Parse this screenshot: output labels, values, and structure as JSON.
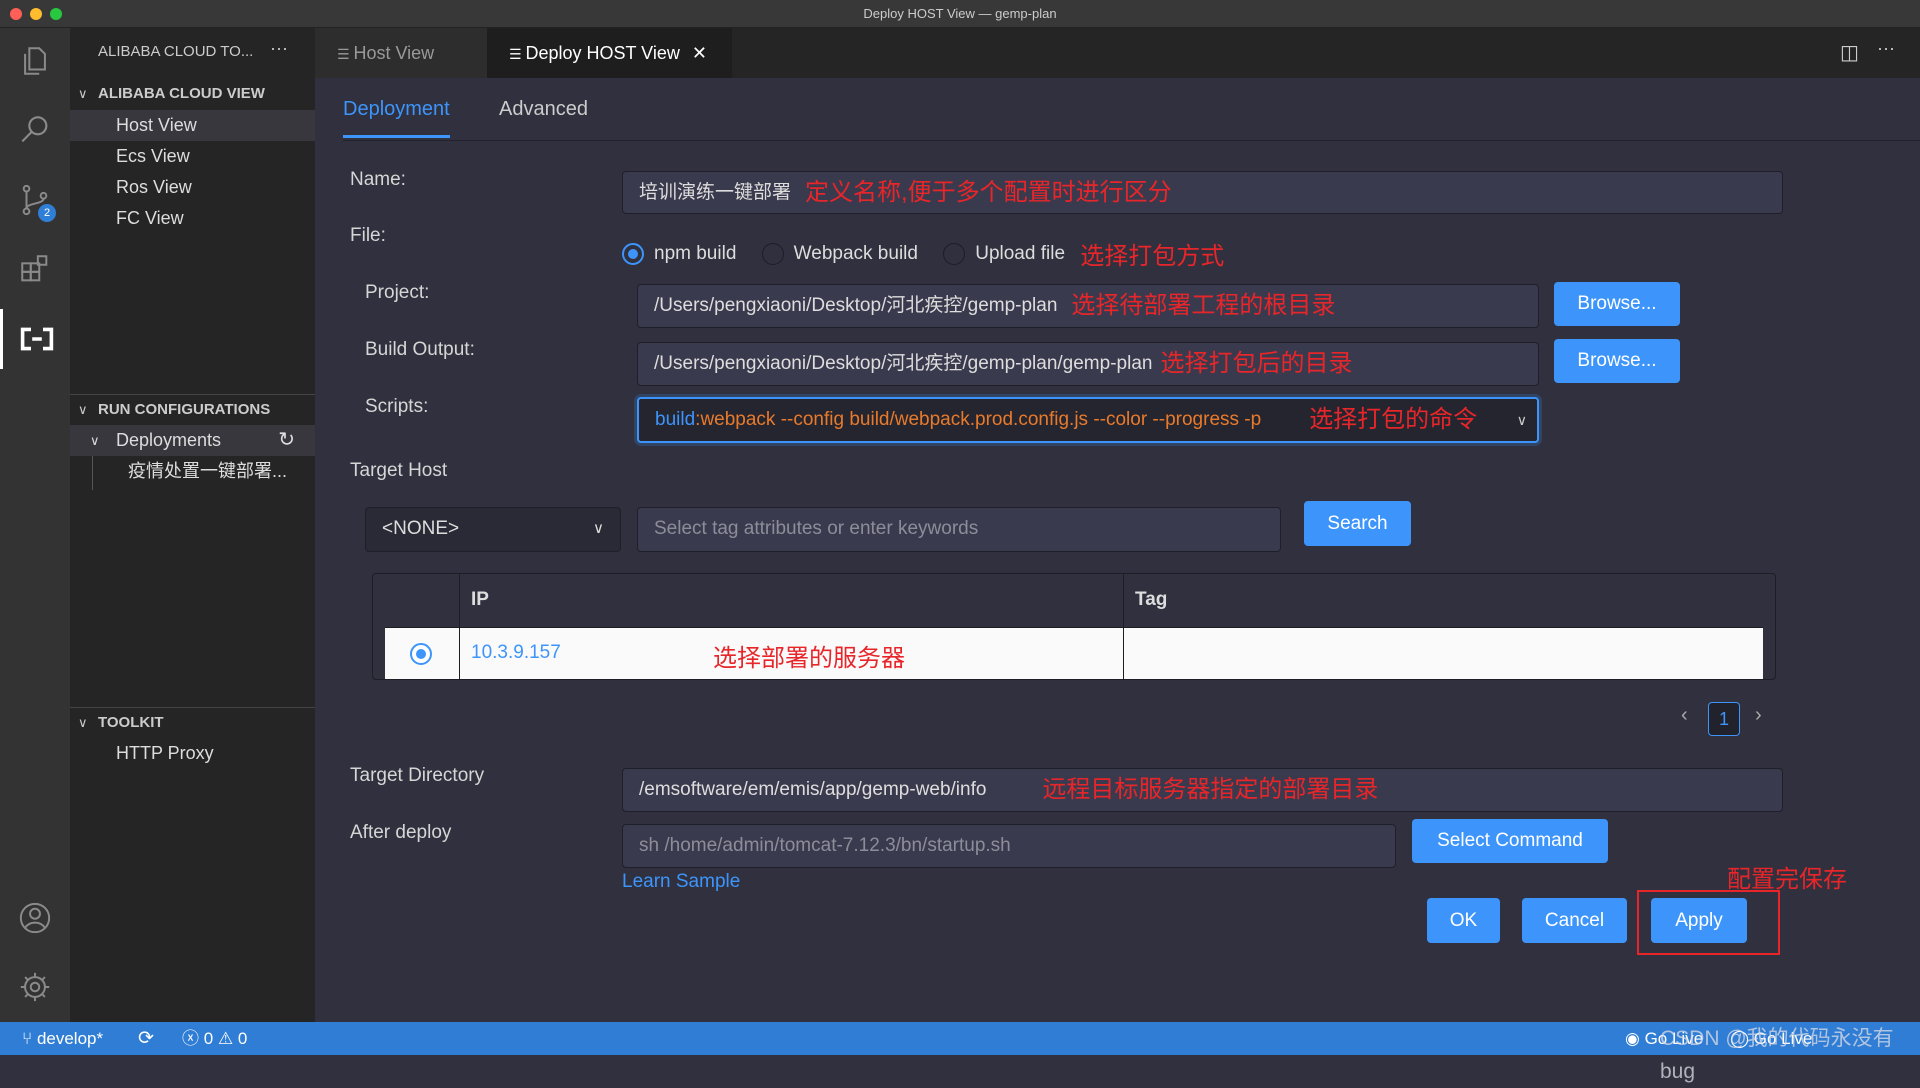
{
  "window": {
    "title": "Deploy HOST View — gemp-plan"
  },
  "activity_bar": {
    "scm_badge": "2",
    "icons": [
      "files-icon",
      "search-icon",
      "source-control-icon",
      "extensions-icon",
      "alibaba-cloud-icon",
      "account-icon",
      "settings-gear-icon"
    ]
  },
  "sidebar": {
    "title": "ALIBABA CLOUD TO...",
    "sections": [
      {
        "label": "ALIBABA CLOUD VIEW",
        "items": [
          "Host View",
          "Ecs View",
          "Ros View",
          "FC View"
        ]
      },
      {
        "label": "RUN CONFIGURATIONS",
        "group": "Deployments",
        "children": [
          "疫情处置一键部署..."
        ]
      },
      {
        "label": "TOOLKIT",
        "items": [
          "HTTP Proxy"
        ]
      }
    ]
  },
  "tabs": [
    {
      "label": "Host View",
      "active": false
    },
    {
      "label": "Deploy HOST View",
      "active": true
    }
  ],
  "form": {
    "tabs": [
      "Deployment",
      "Advanced"
    ],
    "name_label": "Name:",
    "name_value": "培训演练一键部署",
    "name_note": "定义名称,便于多个配置时进行区分",
    "file_label": "File:",
    "file_options": [
      "npm build",
      "Webpack build",
      "Upload file"
    ],
    "file_selected": "npm build",
    "file_note": "选择打包方式",
    "project_label": "Project:",
    "project_value": "/Users/pengxiaoni/Desktop/河北疾控/gemp-plan",
    "project_note": "选择待部署工程的根目录",
    "output_label": "Build Output:",
    "output_value": "/Users/pengxiaoni/Desktop/河北疾控/gemp-plan/gemp-plan",
    "output_note": "选择打包后的目录",
    "browse": "Browse...",
    "scripts_label": "Scripts:",
    "scripts_key": "build",
    "scripts_sep": ":",
    "scripts_cmd": "webpack --config build/webpack.prod.config.js --color --progress -p",
    "scripts_note": "选择打包的命令",
    "target_host_label": "Target Host",
    "tag_select": "<NONE>",
    "search_placeholder": "Select tag attributes or enter keywords",
    "search_button": "Search",
    "table": {
      "headers": [
        "IP",
        "Tag"
      ],
      "rows": [
        {
          "ip": "10.3.9.157",
          "tag": "",
          "selected": true
        }
      ],
      "note": "选择部署的服务器"
    },
    "page": "1",
    "target_dir_label": "Target Directory",
    "target_dir_value": "/emsoftware/em/emis/app/gemp-web/info",
    "target_dir_note": "远程目标服务器指定的部署目录",
    "after_label": "After deploy",
    "after_placeholder": "sh /home/admin/tomcat-7.12.3/bn/startup.sh",
    "select_command": "Select Command",
    "learn_sample": "Learn Sample",
    "ok": "OK",
    "cancel": "Cancel",
    "apply": "Apply",
    "apply_note": "配置完保存"
  },
  "statusbar": {
    "branch": "develop*",
    "errors": "0",
    "warnings": "0",
    "go_live": "Go Live",
    "go_live2": "Go Live",
    "watermark": "CSDN @我的代码永没有bug"
  },
  "colors": {
    "accent": "#3d95fb",
    "annotation": "#e8262a",
    "statusbar": "#2f7dd4"
  }
}
